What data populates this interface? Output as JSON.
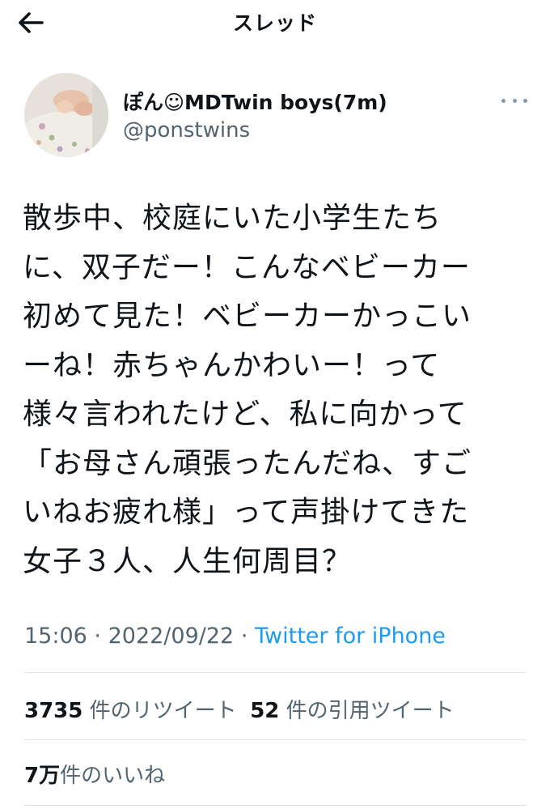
{
  "header": {
    "title": "スレッド"
  },
  "author": {
    "display_name": "ぽん☺MDTwin boys(7m)",
    "handle": "@ponstwins"
  },
  "tweet": {
    "lines": [
      "散歩中、校庭にいた小学生たち",
      "に、双子だー！こんなベビーカー",
      "初めて見た！ベビーカーかっこい",
      "ーね！赤ちゃんかわいー！って",
      "様々言われたけど、私に向かって",
      "「お母さん頑張ったんだね、すご",
      "いねお疲れ様」って声掛けてきた",
      "女子３人、人生何周目？"
    ],
    "time": "15:06",
    "separator": "·",
    "date": "2022/09/22",
    "source": "Twitter for iPhone"
  },
  "stats": {
    "retweets_count": "3735",
    "retweets_label": "件のリツイート",
    "quotes_count": "52",
    "quotes_label": "件の引用ツイート",
    "likes_count": "7万",
    "likes_label": "件のいいね"
  },
  "colors": {
    "text": "#0f1419",
    "secondary": "#536471",
    "link": "#1d9bf0",
    "divider": "#dfe3e6"
  }
}
